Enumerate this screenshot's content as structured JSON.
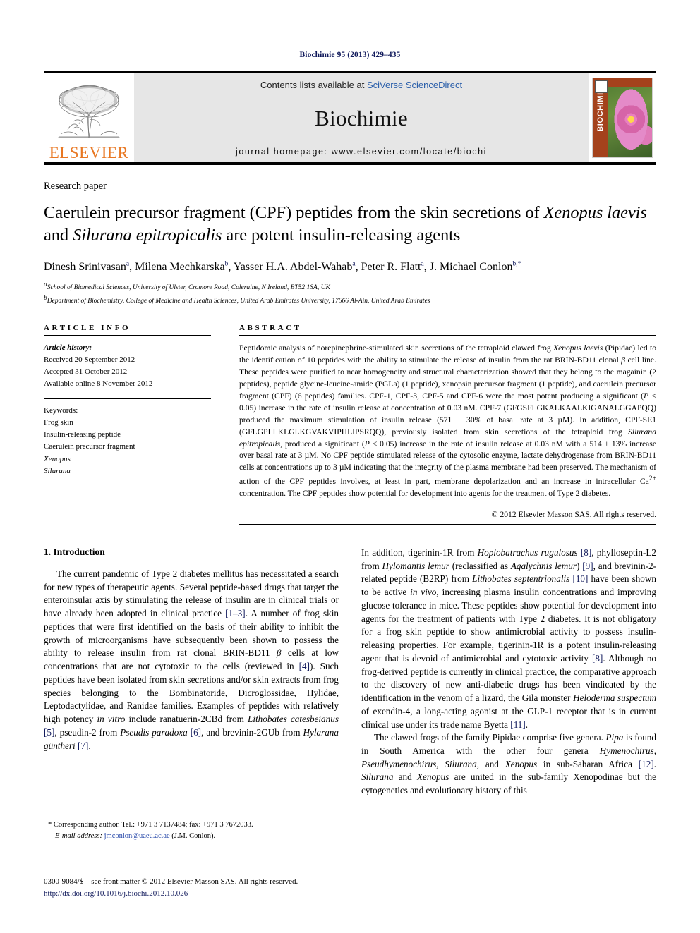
{
  "running_head": "Biochimie 95 (2013) 429–435",
  "masthead": {
    "publisher_logo_text": "ELSEVIER",
    "contents_prefix": "Contents lists available at ",
    "contents_link": "SciVerse ScienceDirect",
    "journal_title": "Biochimie",
    "homepage_label": "journal homepage: www.elsevier.com/locate/biochi",
    "cover_spine_text": "BIOCHIMIE"
  },
  "article": {
    "kind": "Research paper",
    "title_part1": "Caerulein precursor fragment (CPF) peptides from the skin secretions of ",
    "title_italic1": "Xenopus laevis",
    "title_part2": " and ",
    "title_italic2": "Silurana epitropicalis",
    "title_part3": " are potent insulin-releasing agents",
    "authors": [
      {
        "name": "Dinesh Srinivasan",
        "sup": "a",
        "sep": ", "
      },
      {
        "name": "Milena Mechkarska",
        "sup": "b",
        "sep": ", "
      },
      {
        "name": "Yasser H.A. Abdel-Wahab",
        "sup": "a",
        "sep": ", "
      },
      {
        "name": "Peter R. Flatt",
        "sup": "a",
        "sep": ", "
      },
      {
        "name": "J. Michael Conlon",
        "sup": "b,*",
        "sep": ""
      }
    ],
    "affiliations": [
      {
        "sup": "a",
        "text": "School of Biomedical Sciences, University of Ulster, Cromore Road, Coleraine, N Ireland, BT52 1SA, UK"
      },
      {
        "sup": "b",
        "text": "Department of Biochemistry, College of Medicine and Health Sciences, United Arab Emirates University, 17666 Al-Ain, United Arab Emirates"
      }
    ]
  },
  "article_info": {
    "heading": "ARTICLE INFO",
    "history_label": "Article history:",
    "history": [
      "Received 20 September 2012",
      "Accepted 31 October 2012",
      "Available online 8 November 2012"
    ],
    "keywords_label": "Keywords:",
    "keywords": [
      {
        "text": "Frog skin",
        "italic": false
      },
      {
        "text": "Insulin-releasing peptide",
        "italic": false
      },
      {
        "text": "Caerulein precursor fragment",
        "italic": false
      },
      {
        "text": "Xenopus",
        "italic": true
      },
      {
        "text": "Silurana",
        "italic": true
      }
    ]
  },
  "abstract": {
    "heading": "ABSTRACT",
    "text": "Peptidomic analysis of norepinephrine-stimulated skin secretions of the tetraploid clawed frog Xenopus laevis (Pipidae) led to the identification of 10 peptides with the ability to stimulate the release of insulin from the rat BRIN-BD11 clonal β cell line. These peptides were purified to near homogeneity and structural characterization showed that they belong to the magainin (2 peptides), peptide glycine-leucine-amide (PGLa) (1 peptide), xenopsin precursor fragment (1 peptide), and caerulein precursor fragment (CPF) (6 peptides) families. CPF-1, CPF-3, CPF-5 and CPF-6 were the most potent producing a significant (P < 0.05) increase in the rate of insulin release at concentration of 0.03 nM. CPF-7 (GFGSFLGKALKAALKIGANALGGAPQQ) produced the maximum stimulation of insulin release (571 ± 30% of basal rate at 3 μM). In addition, CPF-SE1 (GFLGPLLKLGLKGVAKVIPHLIPSRQQ), previously isolated from skin secretions of the tetraploid frog Silurana epitropicalis, produced a significant (P < 0.05) increase in the rate of insulin release at 0.03 nM with a 514 ± 13% increase over basal rate at 3 μM. No CPF peptide stimulated release of the cytosolic enzyme, lactate dehydrogenase from BRIN-BD11 cells at concentrations up to 3 μM indicating that the integrity of the plasma membrane had been preserved. The mechanism of action of the CPF peptides involves, at least in part, membrane depolarization and an increase in intracellular Ca2+ concentration. The CPF peptides show potential for development into agents for the treatment of Type 2 diabetes.",
    "copyright": "© 2012 Elsevier Masson SAS. All rights reserved."
  },
  "introduction": {
    "heading": "1. Introduction",
    "left_paragraph": "The current pandemic of Type 2 diabetes mellitus has necessitated a search for new types of therapeutic agents. Several peptide-based drugs that target the enteroinsular axis by stimulating the release of insulin are in clinical trials or have already been adopted in clinical practice [1–3]. A number of frog skin peptides that were first identified on the basis of their ability to inhibit the growth of microorganisms have subsequently been shown to possess the ability to release insulin from rat clonal BRIN-BD11 β cells at low concentrations that are not cytotoxic to the cells (reviewed in [4]). Such peptides have been isolated from skin secretions and/or skin extracts from frog species belonging to the Bombinatoride, Dicroglossidae, Hylidae, Leptodactylidae, and Ranidae families. Examples of peptides with relatively high potency in vitro include ranatuerin-2CBd from Lithobates catesbeianus [5], pseudin-2 from Pseudis paradoxa [6], and brevinin-2GUb from Hylarana güntheri [7].",
    "right_paragraph_1": "In addition, tigerinin-1R from Hoplobatrachus rugulosus [8], phylloseptin-L2 from Hylomantis lemur (reclassified as Agalychnis lemur) [9], and brevinin-2-related peptide (B2RP) from Lithobates septentrionalis [10] have been shown to be active in vivo, increasing plasma insulin concentrations and improving glucose tolerance in mice. These peptides show potential for development into agents for the treatment of patients with Type 2 diabetes. It is not obligatory for a frog skin peptide to show antimicrobial activity to possess insulin-releasing properties. For example, tigerinin-1R is a potent insulin-releasing agent that is devoid of antimicrobial and cytotoxic activity [8]. Although no frog-derived peptide is currently in clinical practice, the comparative approach to the discovery of new anti-diabetic drugs has been vindicated by the identification in the venom of a lizard, the Gila monster Heloderma suspectum of exendin-4, a long-acting agonist at the GLP-1 receptor that is in current clinical use under its trade name Byetta [11].",
    "right_paragraph_2": "The clawed frogs of the family Pipidae comprise five genera. Pipa is found in South America with the other four genera Hymenochirus, Pseudhymenochirus, Silurana, and Xenopus in sub-Saharan Africa [12]. Silurana and Xenopus are united in the sub-family Xenopodinae but the cytogenetics and evolutionary history of this"
  },
  "footnote": {
    "corresponding": "* Corresponding author. Tel.: +971 3 7137484; fax: +971 3 7672033.",
    "email_label": "E-mail address:",
    "email": "jmconlon@uaeu.ac.ae",
    "email_owner": "(J.M. Conlon)."
  },
  "footer": {
    "issn_line": "0300-9084/$ – see front matter © 2012 Elsevier Masson SAS. All rights reserved.",
    "doi": "http://dx.doi.org/10.1016/j.biochi.2012.10.026"
  },
  "colors": {
    "link_blue": "#2b5faa",
    "ref_navy": "#111a5c",
    "elsevier_orange": "#e87722",
    "masthead_gray": "#e6e6e6"
  }
}
